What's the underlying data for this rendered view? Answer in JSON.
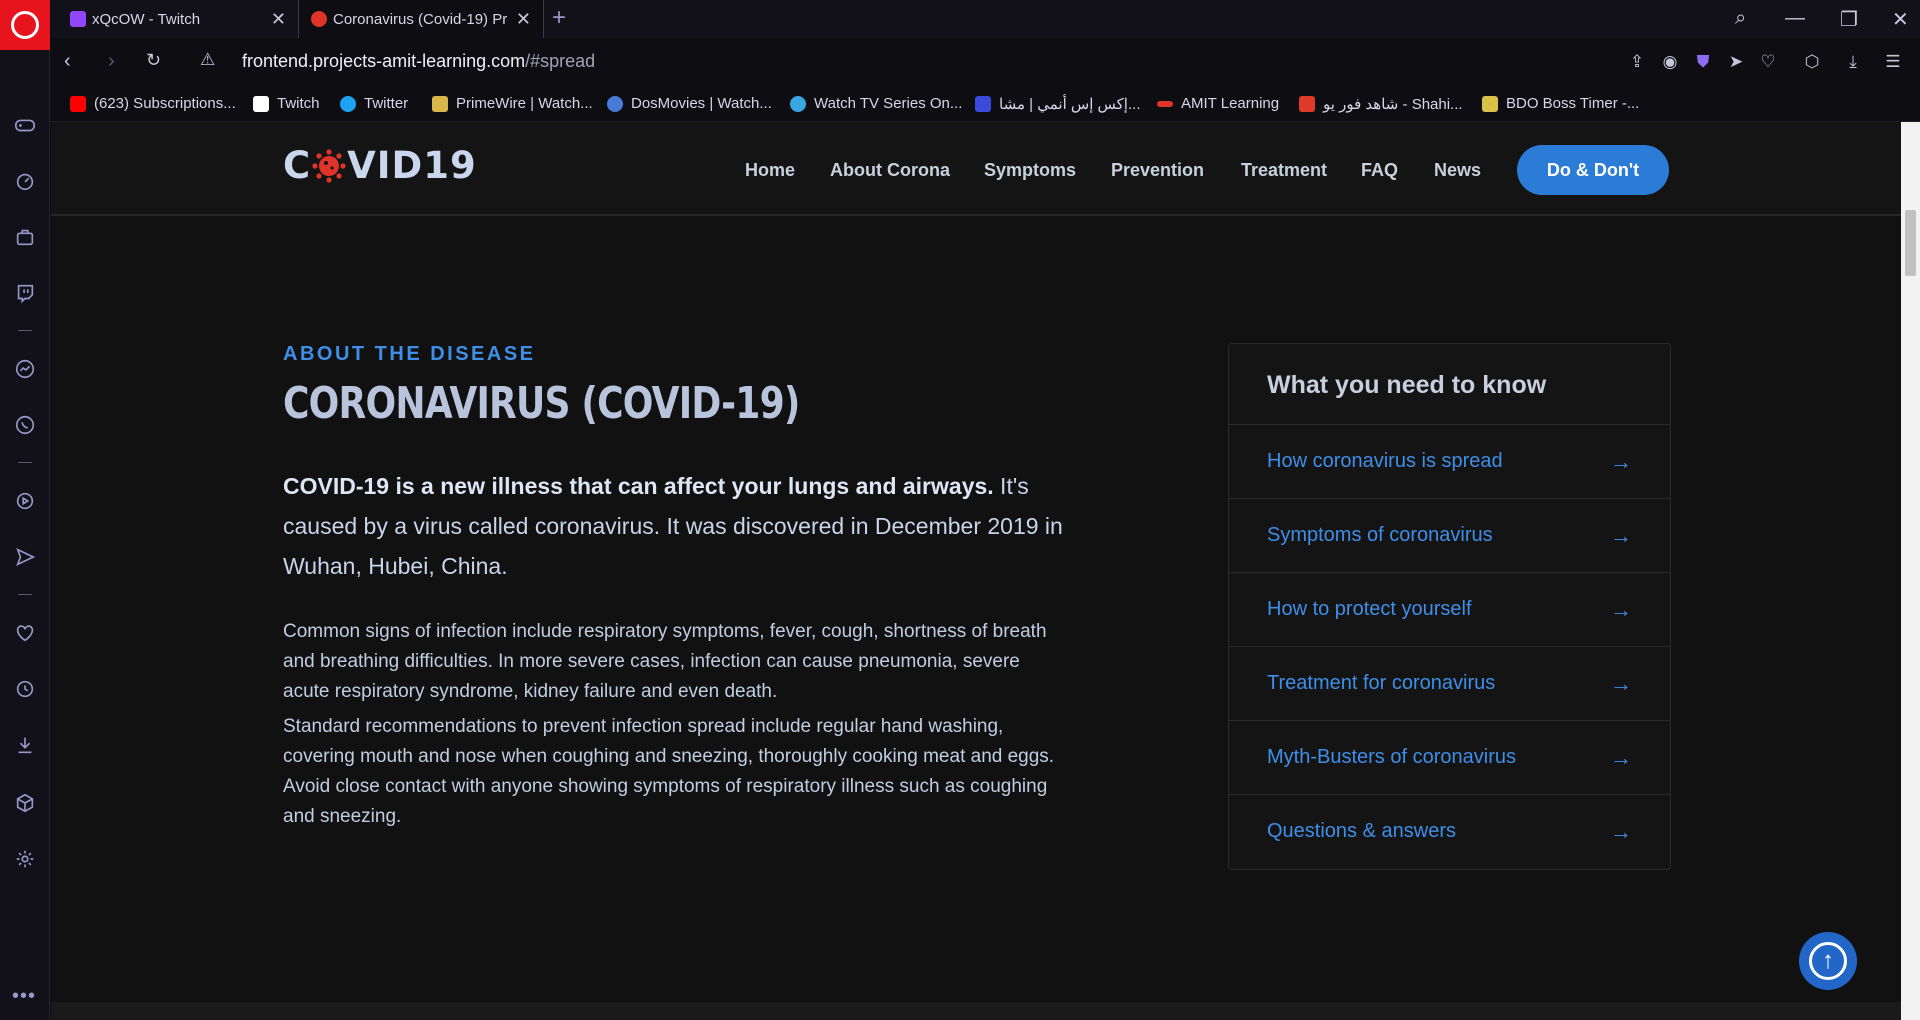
{
  "browser": {
    "tabs": [
      {
        "title": "xQcOW - Twitch",
        "icon_color": "#9146ff"
      },
      {
        "title": "Coronavirus (Covid-19) Pre",
        "icon_color": "#e0342a"
      }
    ],
    "new_tab_symbol": "+",
    "url_domain": "frontend.projects-amit-learning.com",
    "url_path": "/#spread"
  },
  "bookmarks": [
    {
      "label": "(623) Subscriptions...",
      "icon_color": "#ff0000"
    },
    {
      "label": "Twitch",
      "icon_color": "#ffffff"
    },
    {
      "label": "Twitter",
      "icon_color": "#1da1f2"
    },
    {
      "label": "PrimeWire | Watch...",
      "icon_color": "#d9b84a"
    },
    {
      "label": "DosMovies | Watch...",
      "icon_color": "#4a7ad9"
    },
    {
      "label": "Watch TV Series On...",
      "icon_color": "#39a8e0"
    },
    {
      "label": "إكس إس أنمي | مشا...",
      "icon_color": "#3a4ad9"
    },
    {
      "label": "AMIT Learning",
      "icon_color": "#e0342a"
    },
    {
      "label": "شاهد فور يو - Shahi...",
      "icon_color": "#e03a2a"
    },
    {
      "label": "BDO Boss Timer -...",
      "icon_color": "#d9c24a"
    }
  ],
  "site": {
    "logo_left": "C",
    "logo_right": "VID19",
    "nav": [
      "Home",
      "About Corona",
      "Symptoms",
      "Prevention",
      "Treatment",
      "FAQ",
      "News"
    ],
    "cta": "Do & Don't"
  },
  "content": {
    "eyebrow": "ABOUT THE DISEASE",
    "headline": "CORONAVIRUS (COVID-19)",
    "lead_bold": "COVID-19 is a new illness that can affect your lungs and airways.",
    "lead_rest": " It's caused by a virus called coronavirus. It was discovered in December 2019 in Wuhan, Hubei, China.",
    "para1": "Common signs of infection include respiratory symptoms, fever, cough, shortness of breath and breathing difficulties. In more severe cases, infection can cause pneumonia, severe acute respiratory syndrome, kidney failure and even death.",
    "para2": "Standard recommendations to prevent infection spread include regular hand washing, covering mouth and nose when coughing and sneezing, thoroughly cooking meat and eggs. Avoid close contact with anyone showing symptoms of respiratory illness such as coughing and sneezing."
  },
  "card": {
    "title": "What you need to know",
    "items": [
      "How coronavirus is spread",
      "Symptoms of coronavirus",
      "How to protect yourself",
      "Treatment for coronavirus",
      "Myth-Busters of coronavirus",
      "Questions & answers"
    ],
    "arrow": "→"
  },
  "colors": {
    "accent": "#3f8ee8",
    "cta": "#2b7cd6",
    "opera_red": "#e8141d"
  }
}
